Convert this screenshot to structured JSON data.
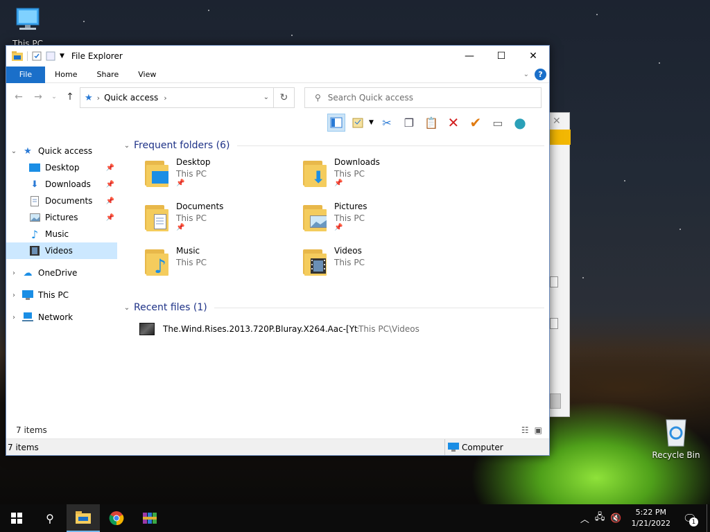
{
  "desktop": {
    "icons": [
      {
        "label": "This PC"
      },
      {
        "label": "Recycle Bin"
      }
    ]
  },
  "window": {
    "title": "File Explorer",
    "ribbon_tabs": [
      "File",
      "Home",
      "Share",
      "View"
    ],
    "help_glyph": "?",
    "address": "Quick access",
    "search_placeholder": "Search Quick access",
    "toolbar_icons": [
      "layout-pane-icon",
      "properties-icon",
      "cut-icon",
      "copy-icon",
      "paste-icon",
      "delete-icon",
      "select-icon",
      "rename-icon",
      "globe-icon"
    ]
  },
  "sidebar": {
    "items": [
      {
        "label": "Quick access",
        "icon": "star-icon",
        "pinned": false
      },
      {
        "label": "Desktop",
        "icon": "desktop-icon",
        "pinned": true
      },
      {
        "label": "Downloads",
        "icon": "download-icon",
        "pinned": true
      },
      {
        "label": "Documents",
        "icon": "document-icon",
        "pinned": true
      },
      {
        "label": "Pictures",
        "icon": "picture-icon",
        "pinned": true
      },
      {
        "label": "Music",
        "icon": "music-icon",
        "pinned": false
      },
      {
        "label": "Videos",
        "icon": "video-icon",
        "pinned": false,
        "selected": true
      },
      {
        "label": "OneDrive",
        "icon": "cloud-icon"
      },
      {
        "label": "This PC",
        "icon": "computer-icon"
      },
      {
        "label": "Network",
        "icon": "network-icon"
      }
    ]
  },
  "content": {
    "frequent_header": "Frequent folders (6)",
    "frequent": [
      {
        "name": "Desktop",
        "location": "This PC",
        "pinned": true
      },
      {
        "name": "Downloads",
        "location": "This PC",
        "pinned": true
      },
      {
        "name": "Documents",
        "location": "This PC",
        "pinned": true
      },
      {
        "name": "Pictures",
        "location": "This PC",
        "pinned": true
      },
      {
        "name": "Music",
        "location": "This PC",
        "pinned": false
      },
      {
        "name": "Videos",
        "location": "This PC",
        "pinned": false
      }
    ],
    "recent_header": "Recent files (1)",
    "recent": [
      {
        "name": "The.Wind.Rises.2013.720P.Bluray.X264.Aac-[Yts....",
        "location": "This PC\\Videos"
      }
    ]
  },
  "status": {
    "items_inner": "7 items",
    "items_outer": "7 items",
    "computer_label": "Computer"
  },
  "taskbar": {
    "time": "5:22 PM",
    "date": "1/21/2022",
    "notification_count": "1"
  },
  "colors": {
    "accent": "#1a6fc9",
    "selection": "#cce8ff",
    "group_header": "#1e3287"
  }
}
